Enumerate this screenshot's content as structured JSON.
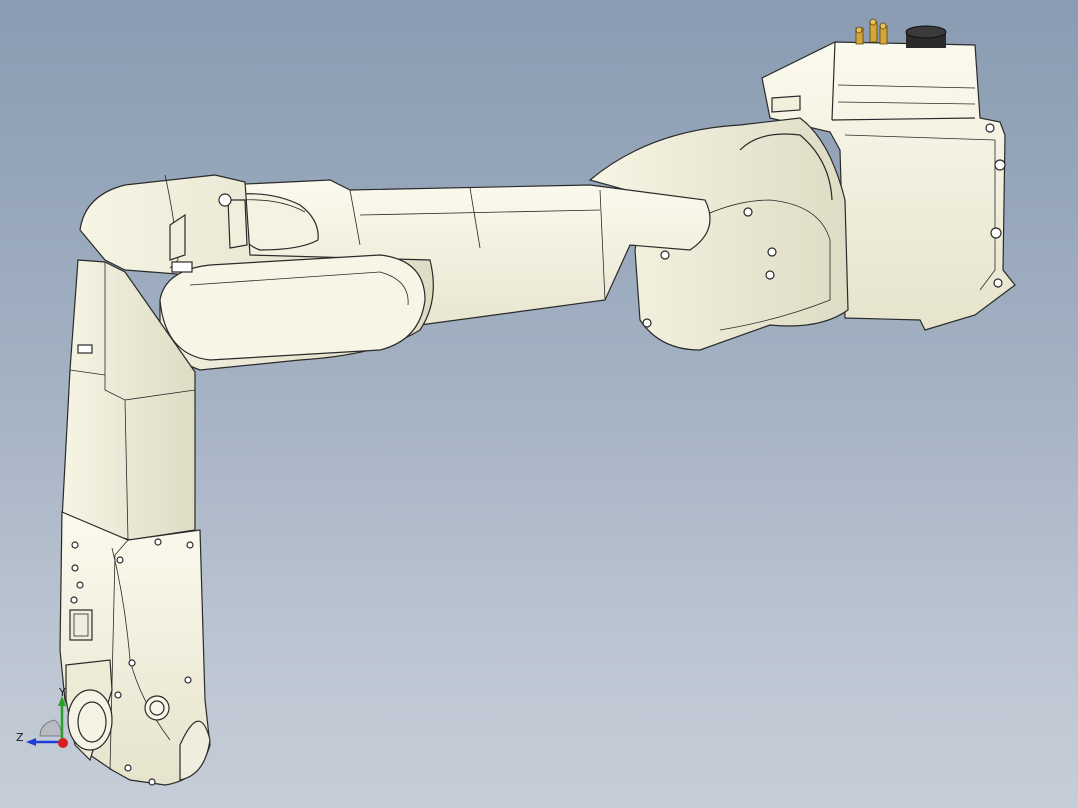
{
  "viewport": {
    "title": "",
    "background_top": "#8a9cb2",
    "background_bottom": "#c6cdd8",
    "body_color": "#f3f2e0",
    "edge_color": "#2a2a2a"
  },
  "model": {
    "name": "",
    "parts": [
      "base-housing",
      "upper-arm-link",
      "elbow-joint",
      "forearm-link",
      "wrist-joint",
      "end-flange"
    ],
    "connector_color": "#d4a63a",
    "cap_color": "#2b2b2b"
  },
  "triad": {
    "axes": [
      {
        "label": "Y",
        "color": "#2aa02a"
      },
      {
        "label": "Z",
        "color": "#1f3fd6"
      },
      {
        "label": "",
        "color": "#d62020"
      }
    ]
  }
}
